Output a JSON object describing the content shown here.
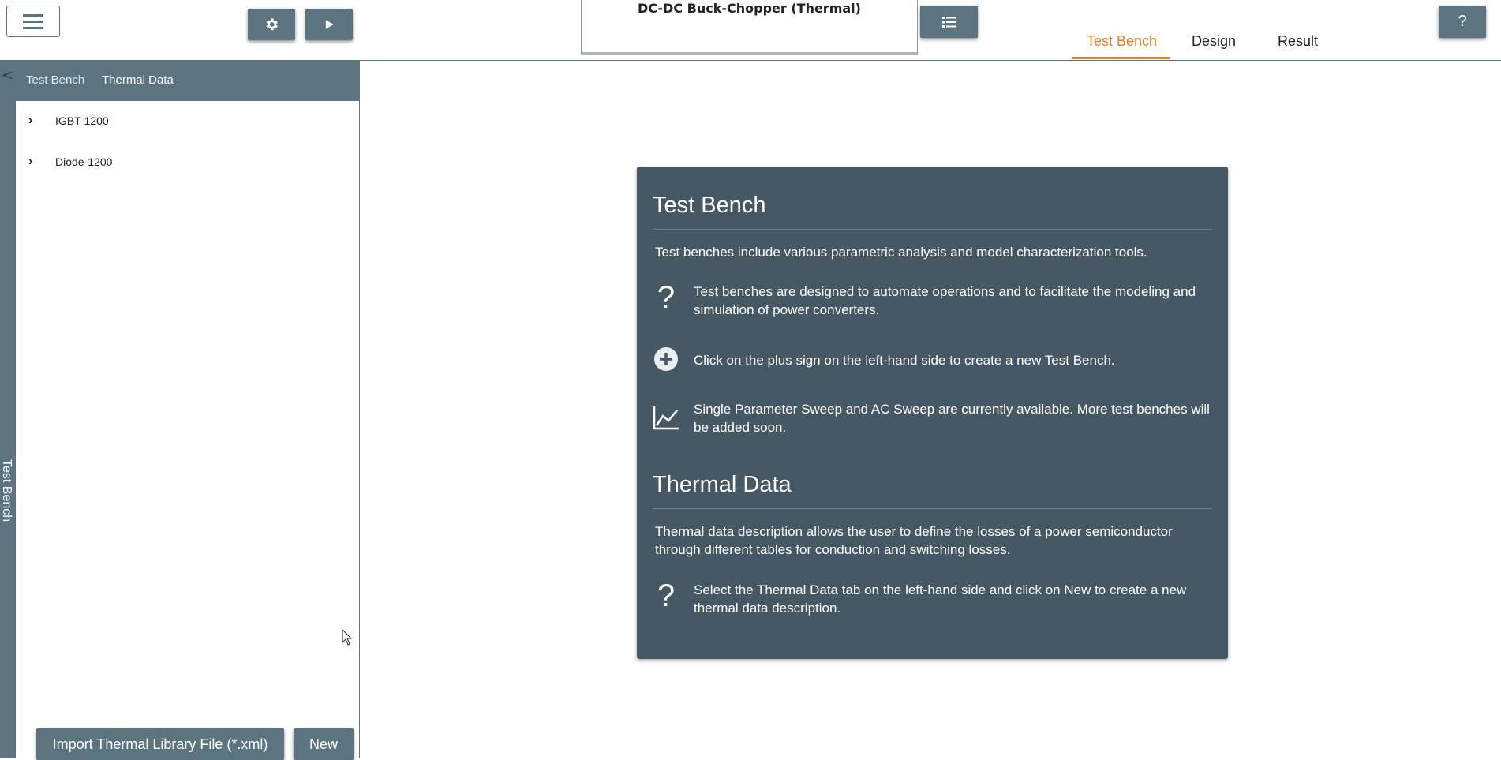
{
  "window": {
    "title": "DC-DC Buck-Chopper (Thermal)"
  },
  "toolbar": {
    "menu_icon": "hamburger-icon",
    "settings_icon": "gear-icon",
    "run_icon": "play-icon",
    "list_icon": "list-icon",
    "help_label": "?"
  },
  "top_tabs": {
    "items": [
      {
        "label": "Test Bench",
        "active": true
      },
      {
        "label": "Design",
        "active": false
      },
      {
        "label": "Result",
        "active": false
      }
    ],
    "active_color": "#f07a2c"
  },
  "left_strip": {
    "label": "Test Bench",
    "collapse_label": "<"
  },
  "left_panel": {
    "tabs": [
      {
        "label": "Test Bench",
        "active": false
      },
      {
        "label": "Thermal Data",
        "active": true
      }
    ],
    "tree": [
      {
        "label": "IGBT-1200",
        "expanded": false
      },
      {
        "label": "Diode-1200",
        "expanded": false
      }
    ],
    "import_label": "Import Thermal Library File (*.xml)",
    "new_label": "New"
  },
  "info_card": {
    "test_bench": {
      "heading": "Test Bench",
      "intro": "Test benches include various parametric analysis and model characterization tools.",
      "rows": [
        {
          "icon": "question-icon",
          "text": "Test benches are designed to automate operations and to facilitate the modeling and simulation of power converters."
        },
        {
          "icon": "plus-circle-icon",
          "text": "Click on the plus sign on the left-hand side to create a new Test Bench."
        },
        {
          "icon": "line-chart-icon",
          "text": "Single Parameter Sweep and AC Sweep are currently available. More test benches will be added soon."
        }
      ]
    },
    "thermal_data": {
      "heading": "Thermal Data",
      "intro": "Thermal data description allows the user to define the losses of a power semiconductor through different tables for conduction and switching losses.",
      "rows": [
        {
          "icon": "question-icon",
          "text": "Select the Thermal Data tab on the left-hand side and click on New to create a new thermal data description."
        }
      ]
    }
  },
  "colors": {
    "slate": "#5c7480",
    "card": "#465863",
    "accent": "#f07a2c"
  }
}
